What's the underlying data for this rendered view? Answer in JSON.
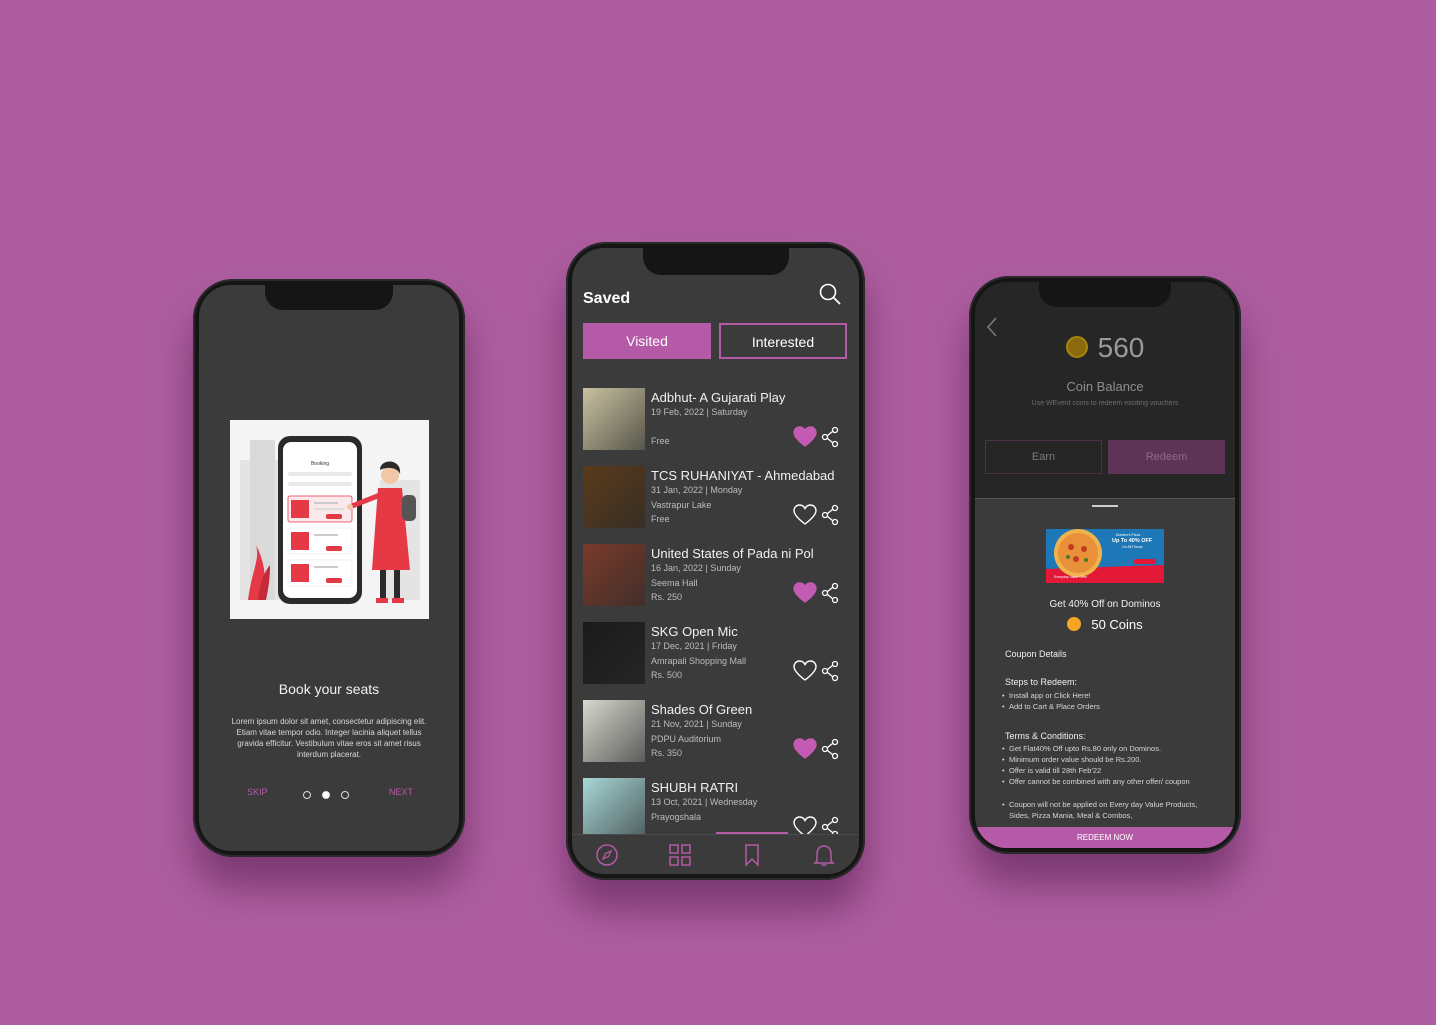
{
  "onboarding": {
    "title": "Book your seats",
    "description": "Lorem ipsum dolor sit amet, consectetur adipiscing elit. Etiam vitae tempor odio. Integer lacinia aliquet tellus gravida efficitur. Vestibulum vitae eros sit amet risus interdum placerat.",
    "skip_label": "SKIP",
    "next_label": "NEXT",
    "illustration_header": "Booking",
    "illustration_rows": [
      "Hotel",
      "Hotel",
      "Hotel"
    ],
    "active_dot": 2,
    "dot_count": 3
  },
  "saved": {
    "title": "Saved",
    "tabs": [
      {
        "label": "Visited",
        "active": true
      },
      {
        "label": "Interested",
        "active": false
      }
    ],
    "events": [
      {
        "title": "Adbhut- A Gujarati Play",
        "date": "19 Feb, 2022 | Saturday",
        "venue": "",
        "price": "Free",
        "liked": true,
        "thumb_color": "#c9c2a0"
      },
      {
        "title": "TCS RUHANIYAT - Ahmedabad",
        "date": "31 Jan, 2022 | Monday",
        "venue": "Vastrapur Lake",
        "price": "Free",
        "liked": false,
        "thumb_color": "#5a3a1a"
      },
      {
        "title": "United States of Pada ni Pol",
        "date": "16 Jan, 2022 | Sunday",
        "venue": "Seema Hall",
        "price": "Rs. 250",
        "liked": true,
        "thumb_color": "#7a3a2a"
      },
      {
        "title": "SKG Open Mic",
        "date": "17 Dec, 2021 | Friday",
        "venue": "Amrapali Shopping Mall",
        "price": "Rs. 500",
        "liked": false,
        "thumb_color": "#1a1a1a"
      },
      {
        "title": "Shades Of Green",
        "date": "21 Nov, 2021 | Sunday",
        "venue": "PDPU Auditorium",
        "price": "Rs. 350",
        "liked": true,
        "thumb_color": "#d8d8d0"
      },
      {
        "title": "SHUBH RATRI",
        "date": "13 Oct, 2021 | Wednesday",
        "venue": "Prayogshala",
        "price": "",
        "liked": false,
        "thumb_color": "#a8d8d8"
      }
    ],
    "nav": [
      "explore-icon",
      "grid-icon",
      "bookmark-icon",
      "bell-icon"
    ],
    "active_nav": "bookmark-icon"
  },
  "wallet": {
    "balance": "560",
    "balance_label": "Coin Balance",
    "balance_sub": "Use WEvent coins to redeem exciting vouchers",
    "earn_label": "Earn",
    "redeem_label": "Redeem",
    "banner": {
      "brand": "Domino's Pizza",
      "headline": "Up To 40% OFF",
      "sub": "On All Pizzas",
      "footer": "Everyday Value Offer"
    },
    "offer_title": "Get 40% Off on Dominos",
    "offer_coins": "50 Coins",
    "coupon_details": "Coupon Details",
    "steps_title": "Steps to Redeem:",
    "steps": [
      "Install app or Click Here!",
      "Add to Cart & Place Orders"
    ],
    "terms_title": "Terms & Conditions:",
    "terms": [
      "Get Flat40% Off upto Rs.80 only on Dominos.",
      "Minimum order value should be Rs.200.",
      "Offer is valid till 28th Feb'22",
      "Offer cannot be combined with any other offer/ coupon",
      "Coupon will not be applied on Every day Value Products, Sides, Pizza Mania, Meal & Combos,"
    ],
    "cta": "REDEEM NOW"
  },
  "colors": {
    "background": "#ae5ea0",
    "accent": "#b55aa6",
    "screen": "#3b3b3b",
    "coin": "#f5a623"
  }
}
